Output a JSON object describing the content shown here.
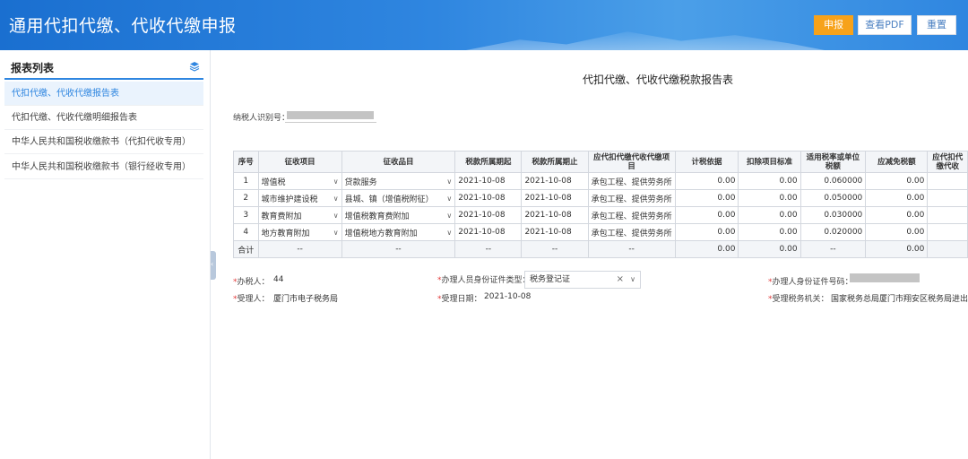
{
  "header": {
    "title": "通用代扣代缴、代收代缴申报",
    "buttons": {
      "submit": "申报",
      "view_pdf": "查看PDF",
      "reset": "重置"
    }
  },
  "sidebar": {
    "title": "报表列表",
    "icon": "layers-icon",
    "items": [
      {
        "label": "代扣代缴、代收代缴报告表",
        "active": true
      },
      {
        "label": "代扣代缴、代收代缴明细报告表",
        "active": false
      },
      {
        "label": "中华人民共和国税收缴款书（代扣代收专用）",
        "active": false
      },
      {
        "label": "中华人民共和国税收缴款书（银行经收专用）",
        "active": false
      }
    ]
  },
  "main": {
    "report_title": "代扣代缴、代收代缴税款报告表",
    "taxpayer_id_label": "纳税人识别号："
  },
  "table": {
    "headers": [
      "序号",
      "征收项目",
      "征收品目",
      "税款所属期起",
      "税款所属期止",
      "应代扣代缴代收代缴项目",
      "计税依据",
      "扣除项目标准",
      "适用税率或单位税额",
      "应减免税额",
      "应代扣代缴代收"
    ],
    "rows": [
      {
        "no": "1",
        "item": "增值税",
        "sub": "贷款服务",
        "start": "2021-10-08",
        "end": "2021-10-08",
        "proj": "承包工程、提供劳务所",
        "basis": "0.00",
        "deduct": "0.00",
        "rate": "0.060000",
        "exempt": "0.00"
      },
      {
        "no": "2",
        "item": "城市维护建设税",
        "sub": "县城、镇（增值税附征）",
        "start": "2021-10-08",
        "end": "2021-10-08",
        "proj": "承包工程、提供劳务所",
        "basis": "0.00",
        "deduct": "0.00",
        "rate": "0.050000",
        "exempt": "0.00"
      },
      {
        "no": "3",
        "item": "教育费附加",
        "sub": "增值税教育费附加",
        "start": "2021-10-08",
        "end": "2021-10-08",
        "proj": "承包工程、提供劳务所",
        "basis": "0.00",
        "deduct": "0.00",
        "rate": "0.030000",
        "exempt": "0.00"
      },
      {
        "no": "4",
        "item": "地方教育附加",
        "sub": "增值税地方教育附加",
        "start": "2021-10-08",
        "end": "2021-10-08",
        "proj": "承包工程、提供劳务所",
        "basis": "0.00",
        "deduct": "0.00",
        "rate": "0.020000",
        "exempt": "0.00"
      }
    ],
    "total": {
      "label": "合计",
      "dash": "--",
      "basis": "0.00",
      "deduct": "0.00",
      "rate": "--",
      "exempt": "0.00"
    }
  },
  "form": {
    "handler_label": "办税人：",
    "handler_value": "44",
    "id_type_label": "办理人员身份证件类型：",
    "id_type_value": "税务登记证",
    "id_no_label": "办理人身份证件号码：",
    "receiver_label": "受理人：",
    "receiver_value": "厦门市电子税务局",
    "receive_date_label": "受理日期：",
    "receive_date_value": "2021-10-08",
    "receive_org_label": "受理税务机关：",
    "receive_org_value": "国家税务总局厦门市翔安区税务局进出口税"
  }
}
